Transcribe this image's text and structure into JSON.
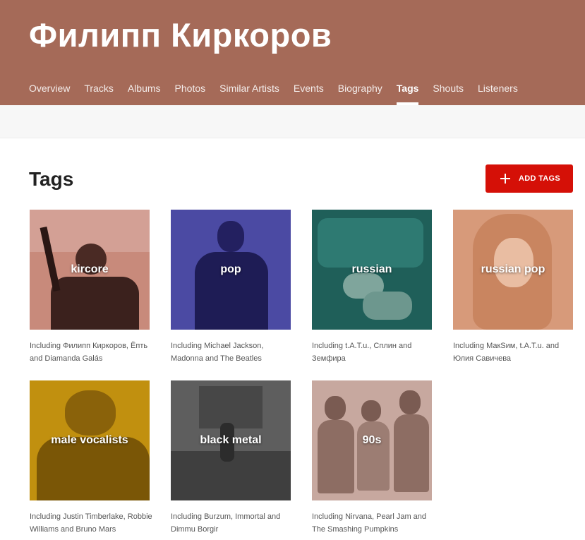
{
  "header": {
    "artist_name": "Филипп Киркоров",
    "nav": [
      "Overview",
      "Tracks",
      "Albums",
      "Photos",
      "Similar Artists",
      "Events",
      "Biography",
      "Tags",
      "Shouts",
      "Listeners"
    ],
    "active_nav": "Tags"
  },
  "main": {
    "section_title": "Tags",
    "add_button_label": "ADD TAGS",
    "tags": [
      {
        "name": "kircore",
        "description": "Including Филипп Киркоров, Ёпть and Diamanda Galás",
        "tint": "#b86f61"
      },
      {
        "name": "pop",
        "description": "Including Michael Jackson, Madonna and The Beatles",
        "tint": "#3d3c9a"
      },
      {
        "name": "russian",
        "description": "Including t.A.T.u., Сплин and Земфира",
        "tint": "#1d5e58"
      },
      {
        "name": "russian pop",
        "description": "Including МакSим, t.A.T.u. and Юлия Савичева",
        "tint": "#d2906f"
      },
      {
        "name": "male vocalists",
        "description": "Including Justin Timberlake, Robbie Williams and Bruno Mars",
        "tint": "#bd8d13"
      },
      {
        "name": "black metal",
        "description": "Including Burzum, Immortal and Dimmu Borgir",
        "tint": "#5a5a5a"
      },
      {
        "name": "90s",
        "description": "Including Nirvana, Pearl Jam and The Smashing Pumpkins",
        "tint": "#bf9d93"
      }
    ]
  }
}
